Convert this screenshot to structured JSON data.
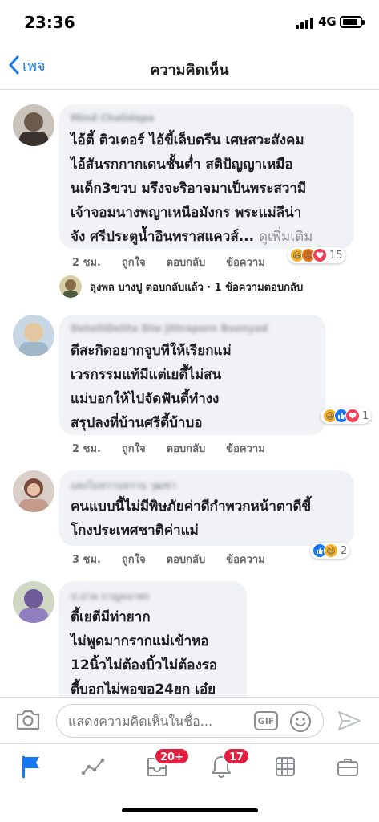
{
  "status": {
    "time": "23:36",
    "network": "4G"
  },
  "nav": {
    "back_label": "เพจ",
    "title": "ความคิดเห็น"
  },
  "comments": [
    {
      "author": "Mind Chalidapa",
      "text": "ไอ้ตี้ ติวเตอร์ ไอ้ขี้เล็บตรีน เศษสวะสังคม\nไอ้สันรกกากเดนชั้นต่ำ สติปัญญาเหมือ\nนเด็ก3ขวบ มรึงจะริอาจมาเป็นพระสวามี\nเจ้าจอมนางพญาเหนือมังกร พระแม่ลีน่า\nจัง ศรีประตูน้ำอินทราสแควส์...",
      "more": "ดูเพิ่มเติม",
      "time": "2 ชม.",
      "like": "ถูกใจ",
      "reply": "ตอบกลับ",
      "message": "ข้อความ",
      "reactions": [
        "haha",
        "angry",
        "love"
      ],
      "reaction_count": "15"
    },
    {
      "author": "DetelliDelita Diw Jittraporn Boonyad",
      "text": "ตีสะกิดอยากจูบทีให้เรียกแม่\nเวรกรรมแท้มีแต่เยตี้ไม่สน\nแม่บอกให้ไปจัดฟันตี้ทำงง\nสรุปลงที่บ้านศรีตี้บ้าบอ",
      "time": "2 ชม.",
      "like": "ถูกใจ",
      "reply": "ตอบกลับ",
      "message": "ข้อความ",
      "reactions": [
        "haha",
        "like",
        "love"
      ],
      "reaction_count": "1"
    },
    {
      "author": "แตงโมหวานหวาน วุฒชา",
      "text": "คนแบบนี้ไม่มีพิษภัยค่าดีกำพวกหน้าตาดีขี้\nโกงประเทศชาติค่าแม่",
      "time": "3 ชม.",
      "like": "ถูกใจ",
      "reply": "ตอบกลับ",
      "message": "ข้อความ",
      "reactions": [
        "like",
        "haha"
      ],
      "reaction_count": "2"
    },
    {
      "author": "ป.ปาล กาญจนาพร",
      "text": "ตี้เยตีมีท่ายาก\nไม่พูดมากรากแม่เข้าหอ\n12นิ้วไม่ต้องบิ้วไม่ต้องรอ\nตี้บอกไม่พอขอ24ยก เอ๋ย"
    }
  ],
  "reply_summary": {
    "name": "ลุงพล บางปู",
    "action": "ตอบกลับแล้ว",
    "count": "· 1 ข้อความตอบกลับ"
  },
  "composer": {
    "placeholder": "แสดงความคิดเห็นในชื่อ...",
    "gif_label": "GIF"
  },
  "tabbar": {
    "badge_marketplace": "20+",
    "badge_notifications": "17"
  },
  "colors": {
    "accent": "#1877f2",
    "bubble": "#f0f2f5",
    "badge": "#e41e3f"
  }
}
